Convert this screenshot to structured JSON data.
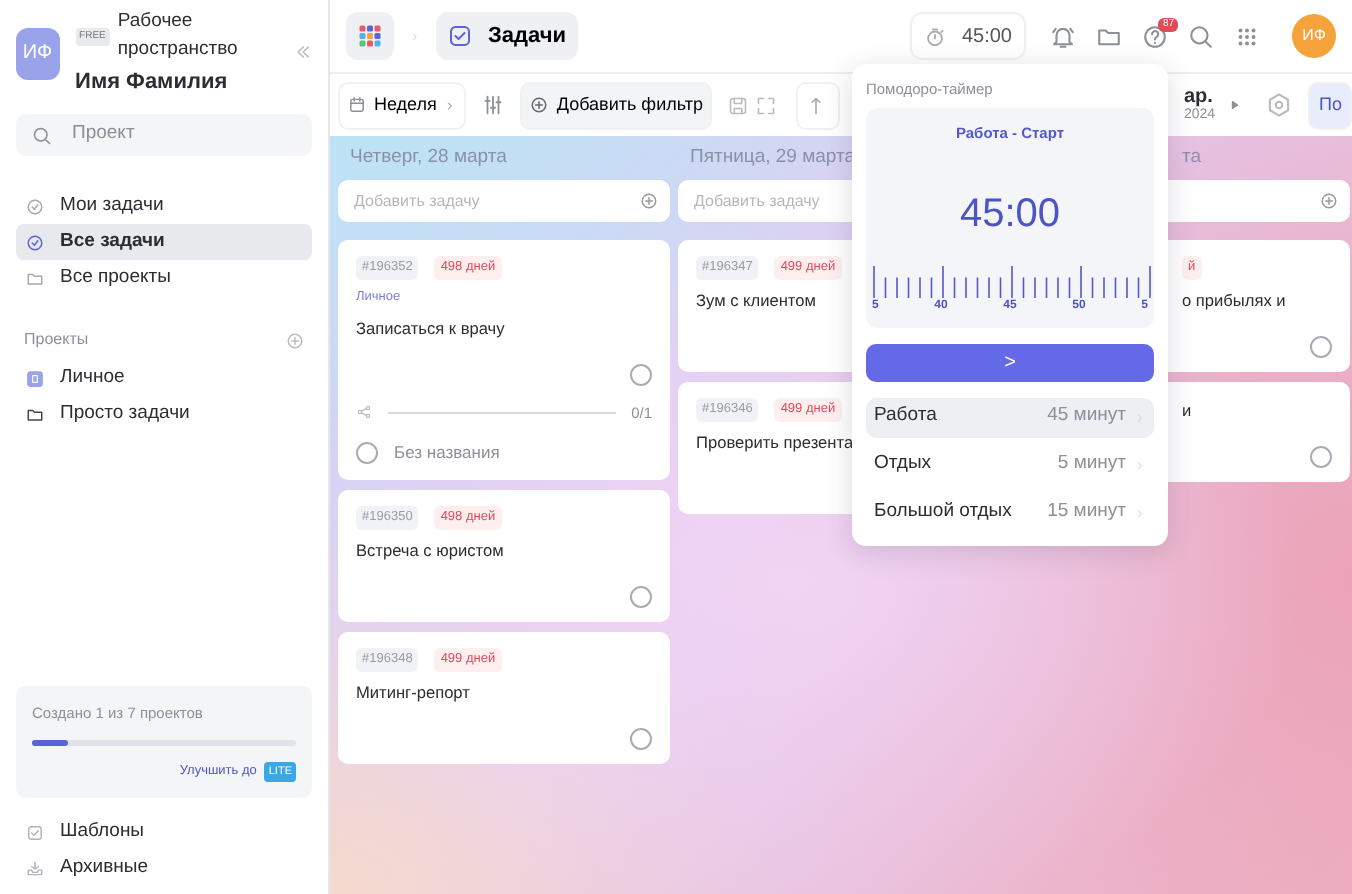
{
  "sidebar": {
    "workspace": {
      "avatar": "ИФ",
      "plan": "FREE",
      "label": "Рабочее пространство",
      "name": "Имя Фамилия"
    },
    "search": {
      "placeholder": "Проект"
    },
    "nav": [
      {
        "label": "Мои задачи",
        "kind": "tasks",
        "selected": false
      },
      {
        "label": "Все задачи",
        "kind": "tasks",
        "selected": true
      },
      {
        "label": "Все проекты",
        "kind": "folder",
        "selected": false
      }
    ],
    "projects_title": "Проекты",
    "projects": [
      {
        "label": "Личное",
        "kind": "personal"
      },
      {
        "label": "Просто задачи",
        "kind": "folder"
      }
    ],
    "quota": {
      "text": "Создано 1 из 7 проектов",
      "level": 0.14,
      "upgrade": "Улучшить до",
      "plan": "LITE"
    },
    "footer": [
      {
        "label": "Шаблоны",
        "kind": "templates"
      },
      {
        "label": "Архивные",
        "kind": "archive"
      }
    ]
  },
  "topbar": {
    "page": "Задачи",
    "timer": "45:00",
    "help_badge": "87",
    "avatar": "ИФ"
  },
  "toolbar": {
    "period": "Неделя",
    "add_filter": "Добавить фильтр",
    "month": "ар.",
    "year": "2024",
    "view": "По"
  },
  "columns": [
    {
      "title": "Четверг, 28 марта",
      "add_placeholder": "Добавить задачу",
      "cards": [
        {
          "id": "#196352",
          "age": "498 дней",
          "project": "Личное",
          "title": "Записаться к врачу",
          "done": false,
          "subtask_progress": {
            "level": 0
          },
          "subtask_count": "0/1",
          "subtask": "Без названия",
          "subtask_done": false
        },
        {
          "id": "#196350",
          "age": "498 дней",
          "title": "Встреча с юристом",
          "done": false
        },
        {
          "id": "#196348",
          "age": "499 дней",
          "title": "Митинг-репорт",
          "done": false
        }
      ]
    },
    {
      "title": "Пятница, 29 марта",
      "add_placeholder": "Добавить задачу",
      "cards": [
        {
          "id": "#196347",
          "age": "499 дней",
          "title": "Зум с клиентом"
        },
        {
          "id": "#196346",
          "age": "499 дней",
          "title": "Проверить презента"
        }
      ]
    },
    {
      "title": "та",
      "cards": [
        {
          "age": "й",
          "title": "о прибылях и",
          "done": false
        },
        {
          "title": "и",
          "done": false
        }
      ]
    }
  ],
  "pomodoro": {
    "title": "Помодоро-таймер",
    "mode": "Работа - Старт",
    "time": "45:00",
    "ticks": [
      "5",
      "40",
      "45",
      "50",
      "5"
    ],
    "start": ">",
    "options": [
      {
        "label": "Работа",
        "duration": "45 минут",
        "selected": true
      },
      {
        "label": "Отдых",
        "duration": "5 минут",
        "selected": false
      },
      {
        "label": "Большой отдых",
        "duration": "15 минут",
        "selected": false
      }
    ]
  }
}
